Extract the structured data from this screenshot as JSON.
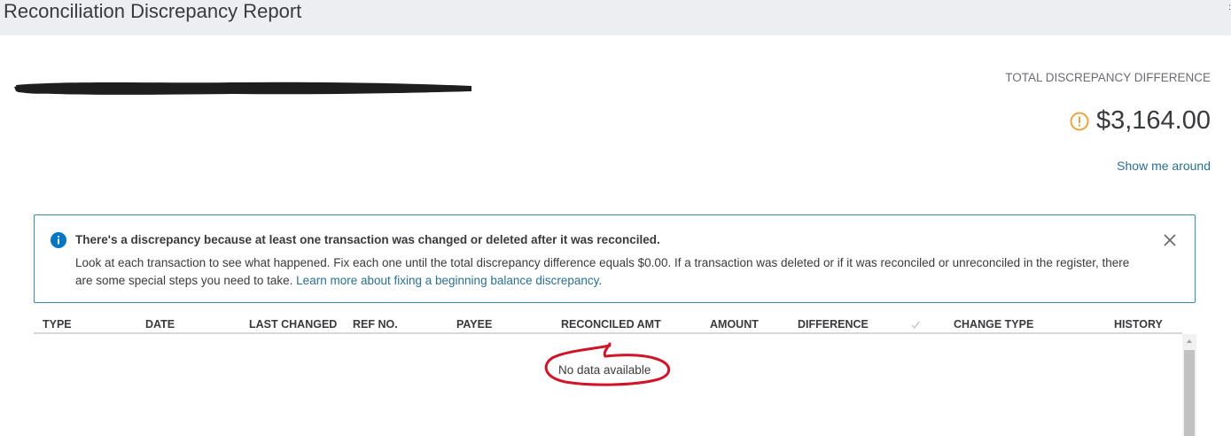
{
  "header": {
    "title": "Reconciliation Discrepancy Report",
    "edge_glyph": ":"
  },
  "summary": {
    "label": "TOTAL DISCREPANCY DIFFERENCE",
    "amount": "$3,164.00",
    "warning_color": "#e8a33d",
    "show_me_around": "Show me around"
  },
  "banner": {
    "title": "There's a discrepancy because at least one transaction was changed or deleted after it was reconciled.",
    "body": "Look at each transaction to see what happened. Fix each one until the total discrepancy difference equals $0.00. If a transaction was deleted or if it was reconciled or unreconciled in the register, there are some special steps you need to take.",
    "link": "Learn more about fixing a beginning balance discrepancy",
    "link_suffix": ".",
    "border_color": "#3a8ea8",
    "info_icon_color": "#0077c5"
  },
  "table": {
    "columns": [
      "TYPE",
      "DATE",
      "LAST CHANGED",
      "REF NO.",
      "PAYEE",
      "RECONCILED AMT",
      "AMOUNT",
      "DIFFERENCE",
      "CHANGE TYPE",
      "HISTORY"
    ],
    "check_icon": "checkmark-icon",
    "empty_message": "No data available"
  },
  "annotation": {
    "color": "#d0142a"
  }
}
